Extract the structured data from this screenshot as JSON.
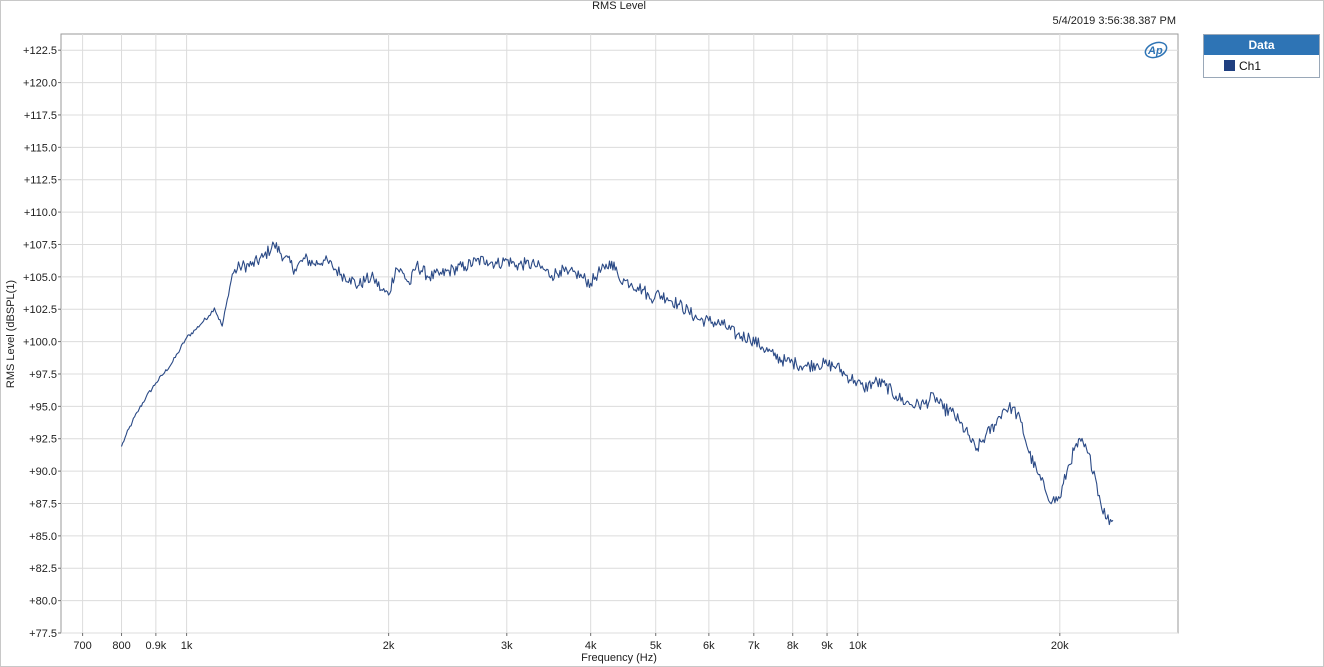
{
  "chart_data": {
    "type": "line",
    "title": "RMS Level",
    "timestamp": "5/4/2019 3:56:38.387 PM",
    "xlabel": "Frequency (Hz)",
    "ylabel": "RMS Level (dBSPL(1)",
    "xscale": "log",
    "xlim": [
      650,
      30000
    ],
    "ylim": [
      77.5,
      123.75
    ],
    "x_ticks": [
      {
        "value": 700,
        "label": "700"
      },
      {
        "value": 800,
        "label": "800"
      },
      {
        "value": 900,
        "label": "0.9k"
      },
      {
        "value": 1000,
        "label": "1k"
      },
      {
        "value": 2000,
        "label": "2k"
      },
      {
        "value": 3000,
        "label": "3k"
      },
      {
        "value": 4000,
        "label": "4k"
      },
      {
        "value": 5000,
        "label": "5k"
      },
      {
        "value": 6000,
        "label": "6k"
      },
      {
        "value": 7000,
        "label": "7k"
      },
      {
        "value": 8000,
        "label": "8k"
      },
      {
        "value": 9000,
        "label": "9k"
      },
      {
        "value": 10000,
        "label": "10k"
      },
      {
        "value": 20000,
        "label": "20k"
      }
    ],
    "y_ticks": [
      {
        "value": 122.5,
        "label": "+122.5"
      },
      {
        "value": 120.0,
        "label": "+120.0"
      },
      {
        "value": 117.5,
        "label": "+117.5"
      },
      {
        "value": 115.0,
        "label": "+115.0"
      },
      {
        "value": 112.5,
        "label": "+112.5"
      },
      {
        "value": 110.0,
        "label": "+110.0"
      },
      {
        "value": 107.5,
        "label": "+107.5"
      },
      {
        "value": 105.0,
        "label": "+105.0"
      },
      {
        "value": 102.5,
        "label": "+102.5"
      },
      {
        "value": 100.0,
        "label": "+100.0"
      },
      {
        "value": 97.5,
        "label": "+97.5"
      },
      {
        "value": 95.0,
        "label": "+95.0"
      },
      {
        "value": 92.5,
        "label": "+92.5"
      },
      {
        "value": 90.0,
        "label": "+90.0"
      },
      {
        "value": 87.5,
        "label": "+87.5"
      },
      {
        "value": 85.0,
        "label": "+85.0"
      },
      {
        "value": 82.5,
        "label": "+82.5"
      },
      {
        "value": 80.0,
        "label": "+80.0"
      },
      {
        "value": 77.5,
        "label": "+77.5"
      }
    ],
    "grid": true,
    "legend_title": "Data",
    "legend_position": "right",
    "series": [
      {
        "name": "Ch1",
        "color": "#2b4a86",
        "x": [
          800,
          810,
          830,
          850,
          870,
          900,
          920,
          950,
          970,
          1000,
          1030,
          1060,
          1080,
          1100,
          1130,
          1170,
          1200,
          1250,
          1300,
          1350,
          1400,
          1450,
          1500,
          1550,
          1600,
          1650,
          1700,
          1750,
          1800,
          1850,
          1900,
          1950,
          2000,
          2050,
          2100,
          2150,
          2200,
          2300,
          2400,
          2500,
          2600,
          2700,
          2800,
          2900,
          3000,
          3100,
          3200,
          3300,
          3400,
          3500,
          3600,
          3700,
          3800,
          3900,
          4000,
          4100,
          4200,
          4300,
          4400,
          4500,
          4600,
          4700,
          4800,
          4900,
          5000,
          5200,
          5400,
          5600,
          5800,
          6000,
          6300,
          6600,
          6900,
          7200,
          7500,
          7800,
          8100,
          8400,
          8700,
          9000,
          9300,
          9600,
          9900,
          10200,
          10600,
          11000,
          11400,
          11800,
          12200,
          12600,
          13000,
          13400,
          13800,
          14200,
          14600,
          15000,
          15500,
          16000,
          16500,
          17000,
          17500,
          18000,
          18500,
          19000,
          19500,
          20000,
          20500,
          21000,
          21500,
          22000,
          22500,
          23000,
          23500,
          24000
        ],
        "values": [
          91.9,
          92.6,
          93.8,
          94.8,
          95.7,
          96.8,
          97.4,
          98.3,
          99.1,
          100.3,
          100.9,
          101.6,
          102.0,
          102.6,
          101.2,
          105.2,
          105.8,
          105.9,
          106.5,
          107.5,
          106.5,
          105.6,
          106.4,
          106.0,
          106.3,
          105.8,
          105.2,
          104.9,
          104.3,
          104.8,
          104.9,
          104.0,
          103.6,
          105.7,
          105.3,
          104.4,
          105.9,
          105.0,
          105.2,
          105.6,
          105.8,
          106.2,
          106.3,
          106.0,
          106.3,
          105.9,
          106.0,
          105.9,
          105.6,
          105.1,
          105.5,
          105.2,
          105.3,
          104.9,
          104.5,
          105.3,
          105.6,
          106.2,
          105.0,
          104.7,
          104.5,
          104.2,
          104.0,
          103.3,
          103.7,
          103.4,
          102.9,
          102.3,
          101.7,
          101.6,
          101.3,
          100.5,
          100.3,
          99.6,
          98.9,
          98.5,
          98.3,
          98.1,
          98.3,
          98.2,
          98.1,
          97.4,
          97.0,
          96.4,
          96.9,
          96.6,
          95.8,
          95.3,
          95.1,
          95.2,
          95.8,
          94.8,
          94.6,
          93.7,
          92.8,
          91.6,
          92.7,
          93.6,
          94.8,
          94.9,
          93.8,
          91.4,
          89.9,
          88.6,
          87.7,
          87.9,
          90.0,
          91.6,
          92.3,
          91.4,
          90.0,
          87.6,
          86.3,
          86.2
        ],
        "jitter_amplitude_db": 0.5
      }
    ]
  }
}
